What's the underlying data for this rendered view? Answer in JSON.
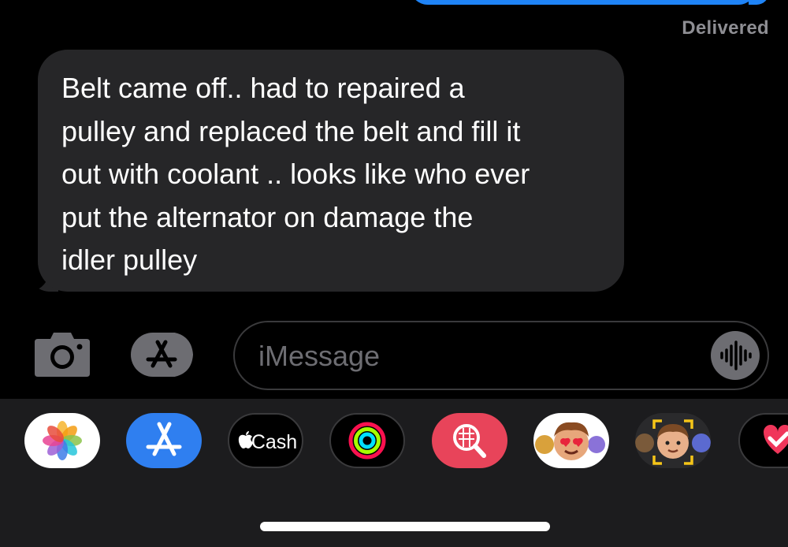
{
  "status": {
    "delivered": "Delivered"
  },
  "message": {
    "text": "Belt came off.. had to repaired a\npulley and replaced the belt and fill it\nout with coolant .. looks like who ever\nput the alternator on damage the\nidler pulley"
  },
  "composer": {
    "placeholder": "iMessage"
  },
  "app_tray": {
    "cash_label": "Cash",
    "apps": [
      "photos-icon",
      "app-store-icon",
      "apple-cash-icon",
      "activity-icon",
      "images-search-icon",
      "memoji-stickers-icon",
      "memoji-icon",
      "digital-touch-icon"
    ]
  },
  "colors": {
    "sent_bubble": "#1f84f7",
    "received_bubble": "#262628",
    "tray_bg": "#1c1c1e"
  }
}
